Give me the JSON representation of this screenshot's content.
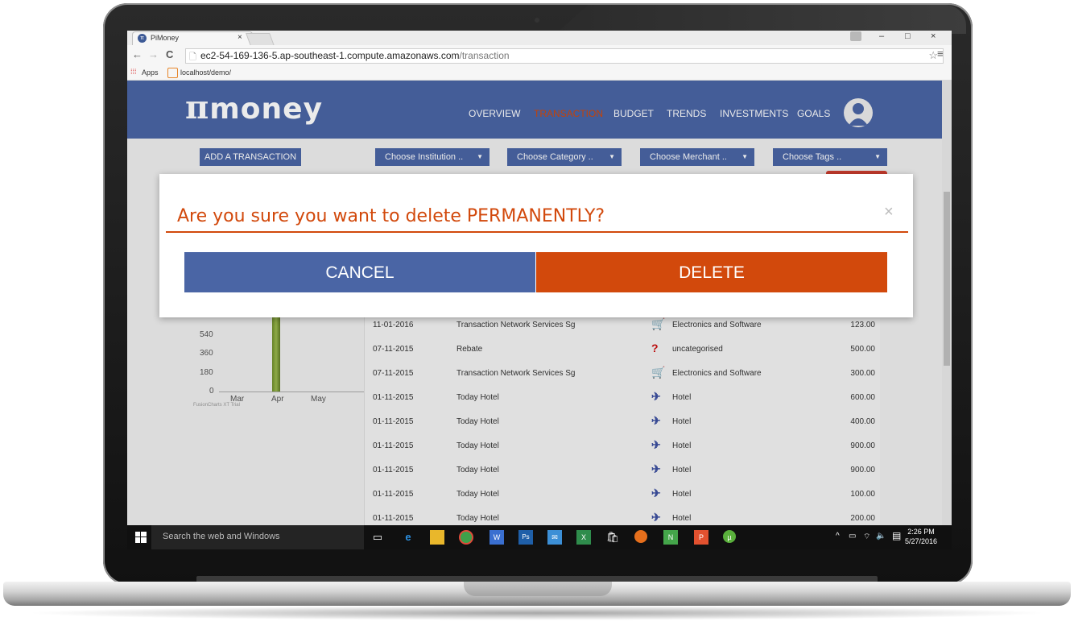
{
  "browser": {
    "tab_title": "PiMoney",
    "tab_icon": "π",
    "tab_close": "×",
    "url_host": "ec2-54-169-136-5.ap-southeast-1.compute.amazonaws.com",
    "url_path": "/transaction",
    "bookmarks": [
      "Apps",
      "localhost/demo/"
    ],
    "window_controls": [
      "–",
      "□",
      "×"
    ]
  },
  "app": {
    "logo": "money",
    "nav": [
      "OVERVIEW",
      "TRANSACTION",
      "BUDGET",
      "TRENDS",
      "INVESTMENTS",
      "GOALS"
    ],
    "active_nav": "TRANSACTION",
    "colors": {
      "primary": "#4a65a5",
      "accent": "#d2490c"
    }
  },
  "filters": {
    "add_button": "ADD A TRANSACTION",
    "dropdowns": [
      "Choose Institution ..",
      "Choose Category ..",
      "Choose Merchant ..",
      "Choose Tags .."
    ]
  },
  "chart": {
    "y_ticks": [
      "540",
      "360",
      "180",
      "0"
    ],
    "x_ticks": [
      "Mar",
      "Apr",
      "May"
    ],
    "credit": "FusionCharts XT Trial"
  },
  "transactions": [
    {
      "date": "11-01-2016",
      "desc": "Transaction Network Services Sg",
      "icon": "cart-icon",
      "glyph": "🛒",
      "category": "Electronics and Software",
      "amount": "123.00"
    },
    {
      "date": "07-11-2015",
      "desc": "Rebate",
      "icon": "question-icon",
      "glyph": "?",
      "category": "uncategorised",
      "amount": "500.00"
    },
    {
      "date": "07-11-2015",
      "desc": "Transaction Network Services Sg",
      "icon": "cart-icon",
      "glyph": "🛒",
      "category": "Electronics and Software",
      "amount": "300.00"
    },
    {
      "date": "01-11-2015",
      "desc": "Today Hotel",
      "icon": "plane-icon",
      "glyph": "✈",
      "category": "Hotel",
      "amount": "600.00"
    },
    {
      "date": "01-11-2015",
      "desc": "Today Hotel",
      "icon": "plane-icon",
      "glyph": "✈",
      "category": "Hotel",
      "amount": "400.00"
    },
    {
      "date": "01-11-2015",
      "desc": "Today Hotel",
      "icon": "plane-icon",
      "glyph": "✈",
      "category": "Hotel",
      "amount": "900.00"
    },
    {
      "date": "01-11-2015",
      "desc": "Today Hotel",
      "icon": "plane-icon",
      "glyph": "✈",
      "category": "Hotel",
      "amount": "900.00"
    },
    {
      "date": "01-11-2015",
      "desc": "Today Hotel",
      "icon": "plane-icon",
      "glyph": "✈",
      "category": "Hotel",
      "amount": "100.00"
    },
    {
      "date": "01-11-2015",
      "desc": "Today Hotel",
      "icon": "plane-icon",
      "glyph": "✈",
      "category": "Hotel",
      "amount": "200.00"
    }
  ],
  "modal": {
    "title_prefix": "Are you sure you want to delete ",
    "title_emph": "PERMANENTLY?",
    "close": "×",
    "cancel": "CANCEL",
    "delete": "DELETE"
  },
  "taskbar": {
    "search_placeholder": "Search the web and Windows",
    "time": "2:26 PM",
    "date": "5/27/2016"
  }
}
